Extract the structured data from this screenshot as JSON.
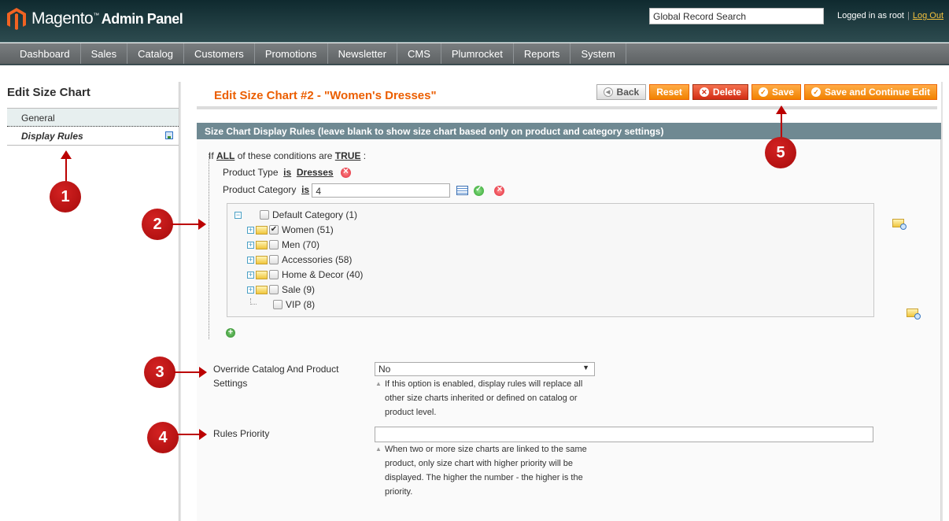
{
  "header": {
    "logo_text": "Magento",
    "logo_suffix": "Admin Panel",
    "search_placeholder": "Global Record Search",
    "logged_in": "Logged in as root",
    "separator": "|",
    "logout": "Log Out"
  },
  "nav": {
    "items": [
      {
        "label": "Dashboard"
      },
      {
        "label": "Sales"
      },
      {
        "label": "Catalog"
      },
      {
        "label": "Customers"
      },
      {
        "label": "Promotions"
      },
      {
        "label": "Newsletter"
      },
      {
        "label": "CMS"
      },
      {
        "label": "Plumrocket"
      },
      {
        "label": "Reports"
      },
      {
        "label": "System"
      }
    ]
  },
  "sidebar": {
    "title": "Edit Size Chart",
    "tabs": [
      {
        "label": "General"
      },
      {
        "label": "Display Rules"
      }
    ]
  },
  "page": {
    "title": "Edit Size Chart #2 - \"Women's Dresses\"",
    "buttons": {
      "back": "Back",
      "reset": "Reset",
      "delete": "Delete",
      "save": "Save",
      "save_continue": "Save and Continue Edit"
    }
  },
  "fieldset": {
    "heading": "Size Chart Display Rules (leave blank to show size chart based only on product and category settings)",
    "conditions": {
      "if": "If",
      "aggregator": "ALL",
      "middle": "of these conditions are",
      "value": "TRUE",
      "colon": ":",
      "rule1_attr": "Product Type",
      "rule1_op": "is",
      "rule1_val": "Dresses",
      "rule2_attr": "Product Category",
      "rule2_op": "is",
      "rule2_val": "4"
    },
    "tree": [
      {
        "label": "Default Category (1)",
        "checked": false
      },
      {
        "label": "Women (51)",
        "checked": true
      },
      {
        "label": "Men (70)",
        "checked": false
      },
      {
        "label": "Accessories (58)",
        "checked": false
      },
      {
        "label": "Home & Decor (40)",
        "checked": false
      },
      {
        "label": "Sale (9)",
        "checked": false
      },
      {
        "label": "VIP (8)",
        "checked": false
      }
    ],
    "override": {
      "label_line1": "Override Catalog And Product",
      "label_line2": "Settings",
      "value": "No",
      "note": "If this option is enabled, display rules will replace all other size charts inherited or defined on catalog or product level."
    },
    "priority": {
      "label": "Rules Priority",
      "value": "",
      "note": "When two or more size charts are linked to the same product, only size chart with higher priority will be displayed. The higher the number - the higher is the priority."
    }
  },
  "callouts": [
    "1",
    "2",
    "3",
    "4",
    "5"
  ],
  "colors": {
    "accent": "#eb5e00",
    "button_orange": "#f18200",
    "button_red": "#d22d14",
    "fieldset_head": "#6f8992",
    "callout": "#b00000"
  }
}
